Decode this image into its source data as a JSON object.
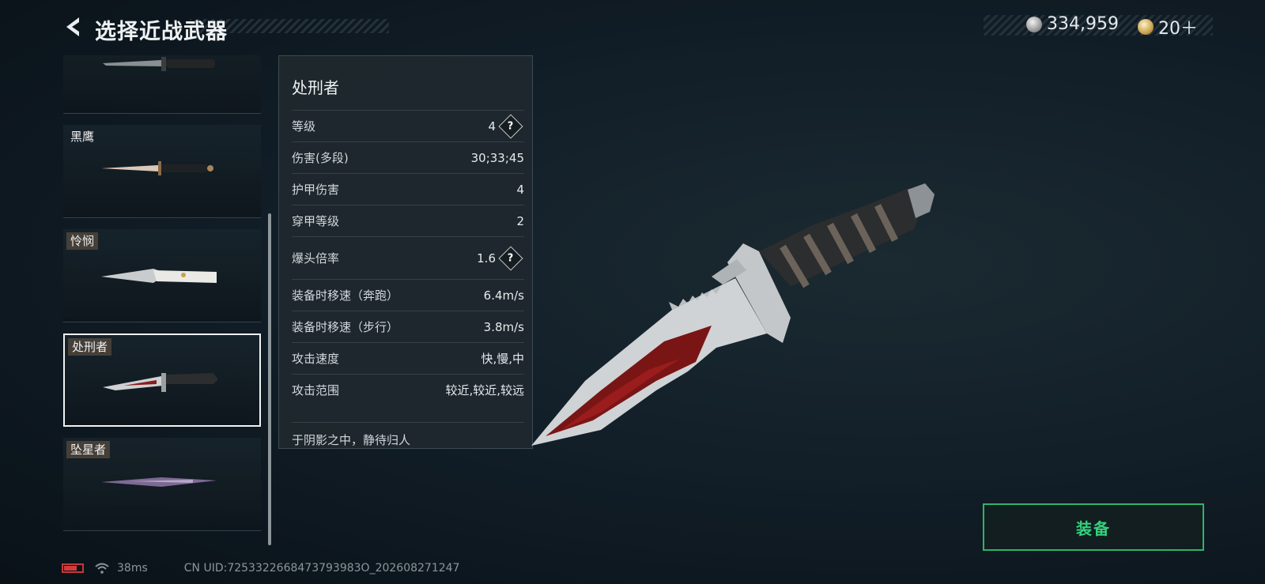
{
  "header": {
    "title": "选择近战武器",
    "currency_silver": "334,959",
    "currency_gold": "20＋"
  },
  "weapon_list": [
    {
      "name": "",
      "selected": false
    },
    {
      "name": "黑鹰",
      "selected": false
    },
    {
      "name": "怜悯",
      "selected": false
    },
    {
      "name": "处刑者",
      "selected": true
    },
    {
      "name": "坠星者",
      "selected": false
    }
  ],
  "weapon": {
    "name": "处刑者",
    "stats": [
      {
        "label": "等级",
        "value": "4",
        "help": true
      },
      {
        "label": "伤害(多段)",
        "value": "30;33;45",
        "help": false
      },
      {
        "label": "护甲伤害",
        "value": "4",
        "help": false
      },
      {
        "label": "穿甲等级",
        "value": "2",
        "help": false
      },
      {
        "label": "爆头倍率",
        "value": "1.6",
        "help": true
      },
      {
        "label": "装备时移速（奔跑）",
        "value": "6.4m/s",
        "help": false
      },
      {
        "label": "装备时移速（步行）",
        "value": "3.8m/s",
        "help": false
      },
      {
        "label": "攻击速度",
        "value": "快,慢,中",
        "help": false
      },
      {
        "label": "攻击范围",
        "value": "较近,较近,较远",
        "help": false
      }
    ],
    "flavor": "于阴影之中，静待归人"
  },
  "equip_label": "装备",
  "status": {
    "ping": "38ms",
    "uid": "CN UID:7253322668473793983О_202608271247"
  },
  "colors": {
    "accent": "#34d07c",
    "battery": "#d13b3b"
  }
}
